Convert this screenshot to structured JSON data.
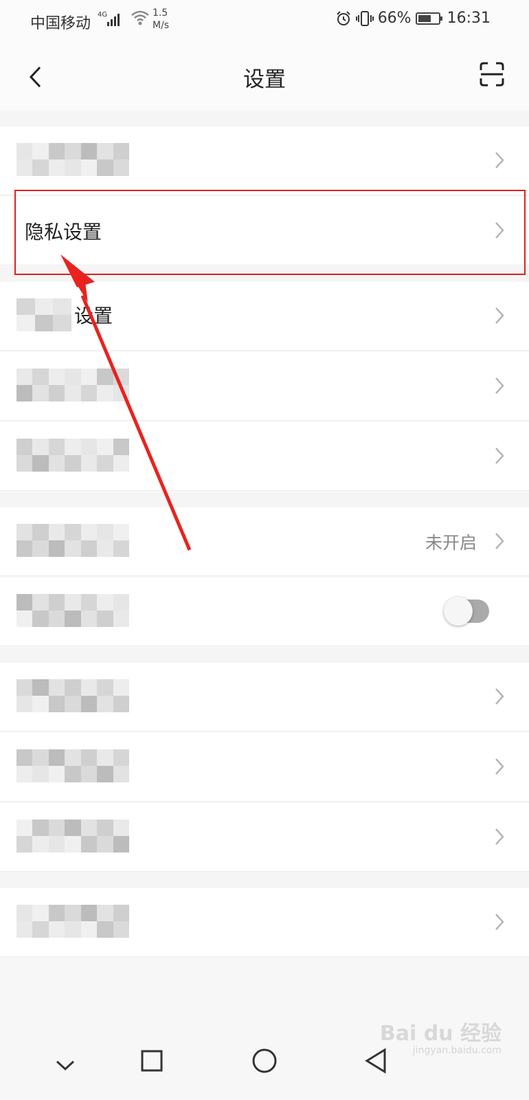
{
  "status_bar": {
    "carrier": "中国移动",
    "network": "4G",
    "speed_value": "1.5",
    "speed_unit": "M/s",
    "battery_percent": "66%",
    "battery_level": 0.66,
    "time": "16:31",
    "icons": [
      "signal-icon",
      "wifi-icon",
      "alarm-icon",
      "vibrate-icon",
      "battery-icon"
    ]
  },
  "header": {
    "title": "设置",
    "back_icon": "back-chevron-icon",
    "scan_icon": "scan-icon"
  },
  "settings": {
    "rows": [
      {
        "label": ""
      },
      {
        "label": "隐私设置"
      },
      {
        "label": "设置"
      },
      {
        "label": ""
      },
      {
        "label": ""
      },
      {
        "label": "",
        "value": "未开启"
      },
      {
        "label": "",
        "toggle": false
      },
      {
        "label": ""
      },
      {
        "label": ""
      },
      {
        "label": ""
      },
      {
        "label": ""
      }
    ]
  },
  "annotation": {
    "highlight_color": "#e0201e"
  },
  "navbar": {
    "icons": [
      "collapse-chevron-icon",
      "recents-square-icon",
      "home-circle-icon",
      "back-triangle-icon"
    ]
  },
  "watermark": {
    "brand": "Bai du 经验",
    "url": "jingyan.baidu.com"
  }
}
